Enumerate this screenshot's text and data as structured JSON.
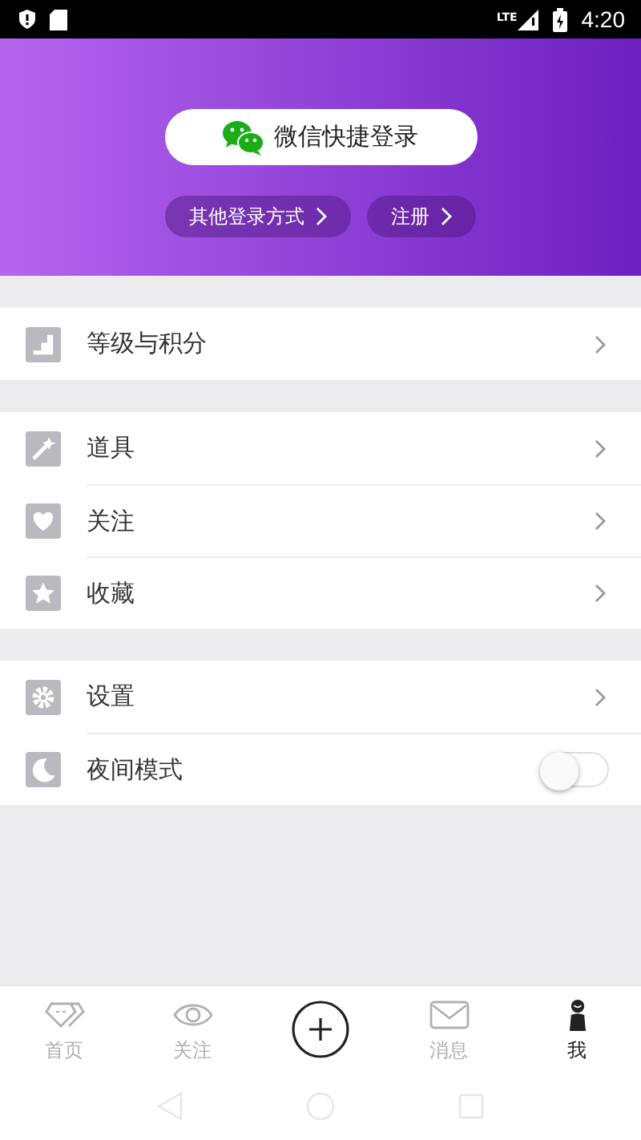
{
  "status_bar": {
    "network": "LTE",
    "time": "4:20"
  },
  "login": {
    "wechat_button": "微信快捷登录",
    "other_button": "其他登录方式",
    "register_button": "注册"
  },
  "sections": [
    {
      "items": [
        {
          "kind": "link",
          "label": "等级与积分"
        }
      ]
    },
    {
      "items": [
        {
          "kind": "link",
          "label": "道具"
        },
        {
          "kind": "link",
          "label": "关注"
        },
        {
          "kind": "link",
          "label": "收藏"
        }
      ]
    },
    {
      "items": [
        {
          "kind": "link",
          "label": "设置"
        },
        {
          "kind": "toggle",
          "label": "夜间模式",
          "on": false
        }
      ]
    }
  ],
  "tab_bar": [
    {
      "kind": "tab",
      "label": "首页",
      "selected": false
    },
    {
      "kind": "tab",
      "label": "关注",
      "selected": false
    },
    {
      "kind": "plus",
      "selected": false
    },
    {
      "kind": "tab",
      "label": "消息",
      "selected": false
    },
    {
      "kind": "tab",
      "label": "我",
      "selected": true
    }
  ]
}
